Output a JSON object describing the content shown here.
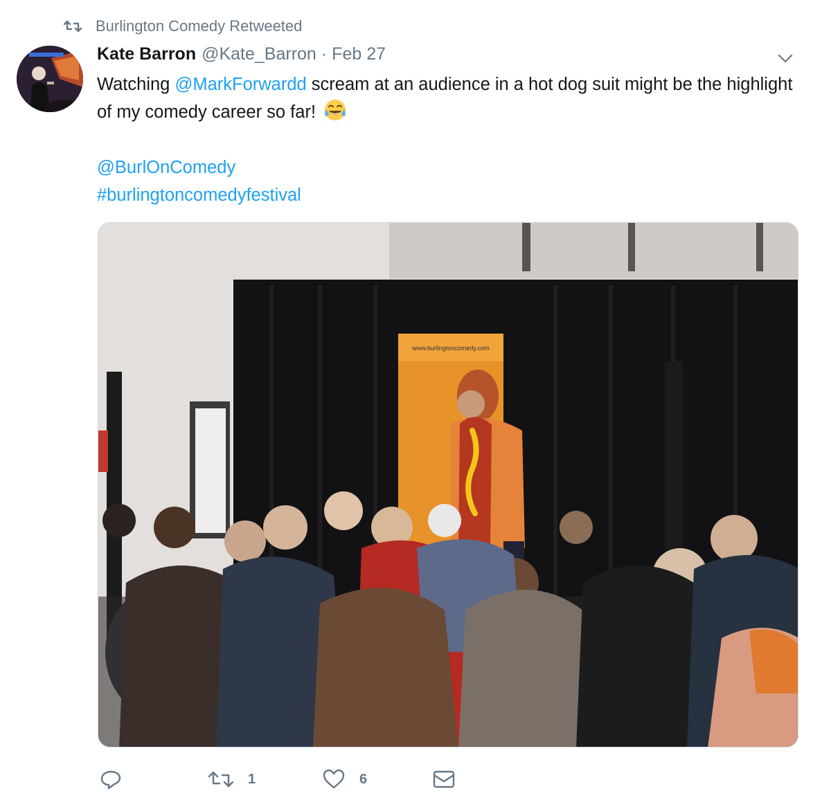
{
  "retweet_context": {
    "text": "Burlington Comedy Retweeted",
    "icon": "retweet-icon"
  },
  "tweet": {
    "author_name": "Kate Barron",
    "author_handle": "@Kate_Barron",
    "separator": "·",
    "date": "Feb 27",
    "text_part1": "Watching ",
    "mention": "@MarkForwardd",
    "text_part2": " scream at an audience in a hot dog suit might be the highlight of my comedy career so far! ",
    "emoji": "face-with-tears-of-joy",
    "tags": [
      "@BurlOnComedy",
      "#burlingtoncomedyfestival"
    ]
  },
  "media": {
    "banner_text": "www.burlingtoncomedy.com"
  },
  "actions": {
    "reply_icon": "reply-icon",
    "retweet_count": "1",
    "like_count": "6",
    "dm_icon": "envelope-icon"
  },
  "colors": {
    "link": "#1da1f2",
    "muted": "#657786",
    "text": "#14171a"
  }
}
